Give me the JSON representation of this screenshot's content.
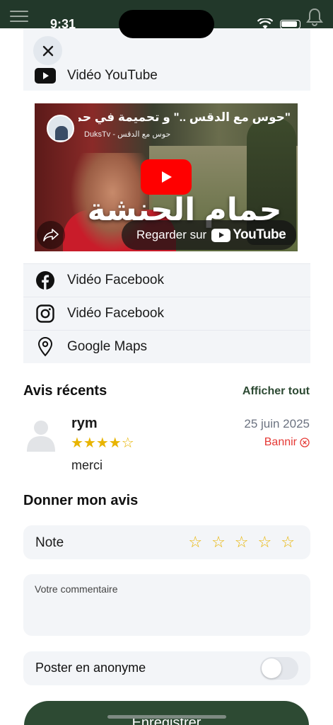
{
  "status_bar": {
    "time": "9:31"
  },
  "links_top": {
    "youtube_label": "Vidéo YouTube"
  },
  "video": {
    "title": "\"حوس مع الدقس ..\" و تحميمة في حمام الحنشة (المدية)",
    "channel": "DuksTv - حوس مع الدقس",
    "overlay_text": "حمام الحنشة",
    "watch_on": "Regarder sur",
    "youtube_brand": "YouTube"
  },
  "links": [
    {
      "label": "Vidéo Facebook",
      "icon": "facebook-icon"
    },
    {
      "label": "Vidéo Facebook",
      "icon": "instagram-icon"
    },
    {
      "label": "Google Maps",
      "icon": "map-pin-icon"
    }
  ],
  "reviews": {
    "title": "Avis récents",
    "see_all": "Afficher tout",
    "items": [
      {
        "name": "rym",
        "stars": "★★★★☆",
        "rating": 4,
        "date": "25 juin 2025",
        "ban": "Bannir",
        "text": "merci"
      }
    ]
  },
  "give_review": {
    "title": "Donner mon avis",
    "note_label": "Note",
    "stars": [
      "☆",
      "☆",
      "☆",
      "☆",
      "☆"
    ],
    "comment_placeholder": "Votre commentaire",
    "anonymous_label": "Poster en anonyme",
    "anonymous_on": false,
    "save_label": "Enregistrer"
  },
  "colors": {
    "primary": "#2d4a33",
    "header": "#22382a",
    "star": "#e8b400",
    "danger": "#e53935"
  }
}
